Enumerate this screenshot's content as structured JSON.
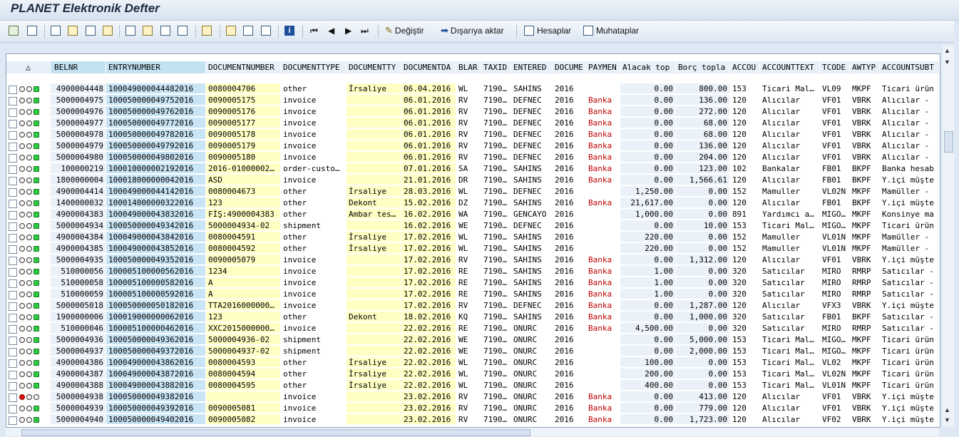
{
  "window": {
    "title": "PLANET Elektronik Defter"
  },
  "toolbar": {
    "change_label": "Değiştir",
    "export_label": "Dışarıya aktar",
    "accounts_label": "Hesaplar",
    "counterparties_label": "Muhataplar",
    "nav": [
      "⏮",
      "◀",
      "▶",
      "⏭"
    ]
  },
  "table": {
    "sort_icon": "△",
    "columns": [
      "BELNR",
      "ENTRYNUMBER",
      "DOCUMENTNUMBER",
      "DOCUMENTTYPE",
      "DOCUMENTTY",
      "DOCUMENTDA",
      "BLAR",
      "TAXID",
      "ENTERED",
      "DOCUME",
      "PAYMEN",
      "Alacak top",
      "Borç topla",
      "ACCOU",
      "ACCOUNTTEXT",
      "TCODE",
      "AWTYP",
      "ACCOUNTSUBT"
    ],
    "rows": [
      [
        "4900004448",
        "100049000044482016",
        "0080004706",
        "other",
        "İrsaliye",
        "06.04.2016",
        "WL",
        "7190…",
        "SAHINS",
        "2016",
        "",
        "0.00",
        "800.00",
        "153",
        "Ticari Mal…",
        "VL09",
        "MKPF",
        "Ticari ürün"
      ],
      [
        "5000004975",
        "100050000049752016",
        "0090005175",
        "invoice",
        "",
        "06.01.2016",
        "RV",
        "7190…",
        "DEFNEC",
        "2016",
        "Banka",
        "0.00",
        "136.00",
        "120",
        "Alıcılar",
        "VF01",
        "VBRK",
        "Alıcılar -"
      ],
      [
        "5000004976",
        "100050000049762016",
        "0090005176",
        "invoice",
        "",
        "06.01.2016",
        "RV",
        "7190…",
        "DEFNEC",
        "2016",
        "Banka",
        "0.00",
        "272.00",
        "120",
        "Alıcılar",
        "VF01",
        "VBRK",
        "Alıcılar -"
      ],
      [
        "5000004977",
        "100050000049772016",
        "0090005177",
        "invoice",
        "",
        "06.01.2016",
        "RV",
        "7190…",
        "DEFNEC",
        "2016",
        "Banka",
        "0.00",
        "68.00",
        "120",
        "Alıcılar",
        "VF01",
        "VBRK",
        "Alıcılar -"
      ],
      [
        "5000004978",
        "100050000049782016",
        "0090005178",
        "invoice",
        "",
        "06.01.2016",
        "RV",
        "7190…",
        "DEFNEC",
        "2016",
        "Banka",
        "0.00",
        "68.00",
        "120",
        "Alıcılar",
        "VF01",
        "VBRK",
        "Alıcılar -"
      ],
      [
        "5000004979",
        "100050000049792016",
        "0090005179",
        "invoice",
        "",
        "06.01.2016",
        "RV",
        "7190…",
        "DEFNEC",
        "2016",
        "Banka",
        "0.00",
        "136.00",
        "120",
        "Alıcılar",
        "VF01",
        "VBRK",
        "Alıcılar -"
      ],
      [
        "5000004980",
        "100050000049802016",
        "0090005180",
        "invoice",
        "",
        "06.01.2016",
        "RV",
        "7190…",
        "DEFNEC",
        "2016",
        "Banka",
        "0.00",
        "204.00",
        "120",
        "Alıcılar",
        "VF01",
        "VBRK",
        "Alıcılar -"
      ],
      [
        "100000219",
        "100010000002192016",
        "2016-01000002…",
        "order-custo…",
        "",
        "07.01.2016",
        "SA",
        "7190…",
        "SAHINS",
        "2016",
        "Banka",
        "0.00",
        "123.00",
        "102",
        "Bankalar",
        "FB01",
        "BKPF",
        "Banka hesab"
      ],
      [
        "1800000004",
        "100018000000042016",
        "ASD",
        "invoice",
        "",
        "21.01.2016",
        "DR",
        "7190…",
        "SAHINS",
        "2016",
        "Banka",
        "0.00",
        "1,566.61",
        "120",
        "Alıcılar",
        "FB01",
        "BKPF",
        "Y.içi müşte"
      ],
      [
        "4900004414",
        "100049000044142016",
        "0080004673",
        "other",
        "İrsaliye",
        "28.03.2016",
        "WL",
        "7190…",
        "DEFNEC",
        "2016",
        "",
        "1,250.00",
        "0.00",
        "152",
        "Mamuller",
        "VL02N",
        "MKPF",
        "Mamüller -"
      ],
      [
        "1400000032",
        "100014000000322016",
        "123",
        "other",
        "Dekont",
        "15.02.2016",
        "DZ",
        "7190…",
        "SAHINS",
        "2016",
        "Banka",
        "21,617.00",
        "0.00",
        "120",
        "Alıcılar",
        "FB01",
        "BKPF",
        "Y.içi müşte"
      ],
      [
        "4900004383",
        "100049000043832016",
        "FİŞ:4900004383",
        "other",
        "Ambar tes…",
        "16.02.2016",
        "WA",
        "7190…",
        "GENCAYO",
        "2016",
        "",
        "1,000.00",
        "0.00",
        "891",
        "Yardımcı a…",
        "MIGO…",
        "MKPF",
        "Konsinye ma"
      ],
      [
        "5000004934",
        "100050000049342016",
        "5000004934-02",
        "shipment",
        "",
        "16.02.2016",
        "WE",
        "7190…",
        "DEFNEC",
        "2016",
        "",
        "0.00",
        "10.00",
        "153",
        "Ticari Mal…",
        "MIGO…",
        "MKPF",
        "Ticari ürün"
      ],
      [
        "4900004384",
        "100049000043842016",
        "0080004591",
        "other",
        "İrsaliye",
        "17.02.2016",
        "WL",
        "7190…",
        "SAHINS",
        "2016",
        "",
        "220.00",
        "0.00",
        "152",
        "Mamuller",
        "VL01N",
        "MKPF",
        "Mamüller -"
      ],
      [
        "4900004385",
        "100049000043852016",
        "0080004592",
        "other",
        "İrsaliye",
        "17.02.2016",
        "WL",
        "7190…",
        "SAHINS",
        "2016",
        "",
        "220.00",
        "0.00",
        "152",
        "Mamuller",
        "VL01N",
        "MKPF",
        "Mamüller -"
      ],
      [
        "5000004935",
        "100050000049352016",
        "0090005079",
        "invoice",
        "",
        "17.02.2016",
        "RV",
        "7190…",
        "SAHINS",
        "2016",
        "Banka",
        "0.00",
        "1,312.00",
        "120",
        "Alıcılar",
        "VF01",
        "VBRK",
        "Y.içi müşte"
      ],
      [
        "510000056",
        "100005100000562016",
        "1234",
        "invoice",
        "",
        "17.02.2016",
        "RE",
        "7190…",
        "SAHINS",
        "2016",
        "Banka",
        "1.00",
        "0.00",
        "320",
        "Satıcılar",
        "MIRO",
        "RMRP",
        "Satıcılar -"
      ],
      [
        "510000058",
        "100005100000582016",
        "A",
        "invoice",
        "",
        "17.02.2016",
        "RE",
        "7190…",
        "SAHINS",
        "2016",
        "Banka",
        "1.00",
        "0.00",
        "320",
        "Satıcılar",
        "MIRO",
        "RMRP",
        "Satıcılar -"
      ],
      [
        "510000059",
        "100005100000592016",
        "A",
        "invoice",
        "",
        "17.02.2016",
        "RE",
        "7190…",
        "SAHINS",
        "2016",
        "Banka",
        "1.00",
        "0.00",
        "320",
        "Satıcılar",
        "MIRO",
        "RMRP",
        "Satıcılar -"
      ],
      [
        "5000005018",
        "100050000050182016",
        "TTA2016000000…",
        "invoice",
        "",
        "17.02.2016",
        "RV",
        "7190…",
        "DEFNEC",
        "2016",
        "Banka",
        "0.00",
        "1,287.00",
        "120",
        "Alıcılar",
        "VFX3",
        "VBRK",
        "Y.içi müşte"
      ],
      [
        "1900000006",
        "100019000000062016",
        "123",
        "other",
        "Dekont",
        "18.02.2016",
        "KQ",
        "7190…",
        "SAHINS",
        "2016",
        "Banka",
        "0.00",
        "1,000.00",
        "320",
        "Satıcılar",
        "FB01",
        "BKPF",
        "Satıcılar -"
      ],
      [
        "510000046",
        "100005100000462016",
        "XXC2015000000…",
        "invoice",
        "",
        "22.02.2016",
        "RE",
        "7190…",
        "ONURC",
        "2016",
        "Banka",
        "4,500.00",
        "0.00",
        "320",
        "Satıcılar",
        "MIRO",
        "RMRP",
        "Satıcılar -"
      ],
      [
        "5000004936",
        "100050000049362016",
        "5000004936-02",
        "shipment",
        "",
        "22.02.2016",
        "WE",
        "7190…",
        "ONURC",
        "2016",
        "",
        "0.00",
        "5,000.00",
        "153",
        "Ticari Mal…",
        "MIGO…",
        "MKPF",
        "Ticari ürün"
      ],
      [
        "5000004937",
        "100050000049372016",
        "5000004937-02",
        "shipment",
        "",
        "22.02.2016",
        "WE",
        "7190…",
        "ONURC",
        "2016",
        "",
        "0.00",
        "2,000.00",
        "153",
        "Ticari Mal…",
        "MIGO…",
        "MKPF",
        "Ticari ürün"
      ],
      [
        "4900004386",
        "100049000043862016",
        "0080004593",
        "other",
        "İrsaliye",
        "22.02.2016",
        "WL",
        "7190…",
        "ONURC",
        "2016",
        "",
        "100.00",
        "0.00",
        "153",
        "Ticari Mal…",
        "VL02",
        "MKPF",
        "Ticari ürün"
      ],
      [
        "4900004387",
        "100049000043872016",
        "0080004594",
        "other",
        "İrsaliye",
        "22.02.2016",
        "WL",
        "7190…",
        "ONURC",
        "2016",
        "",
        "200.00",
        "0.00",
        "153",
        "Ticari Mal…",
        "VL02N",
        "MKPF",
        "Ticari ürün"
      ],
      [
        "4900004388",
        "100049000043882016",
        "0080004595",
        "other",
        "İrsaliye",
        "22.02.2016",
        "WL",
        "7190…",
        "ONURC",
        "2016",
        "",
        "400.00",
        "0.00",
        "153",
        "Ticari Mal…",
        "VL01N",
        "MKPF",
        "Ticari ürün"
      ],
      [
        "5000004938",
        "100050000049382016",
        "",
        "invoice",
        "",
        "23.02.2016",
        "RV",
        "7190…",
        "ONURC",
        "2016",
        "Banka",
        "0.00",
        "413.00",
        "120",
        "Alıcılar",
        "VF01",
        "VBRK",
        "Y.içi müşte"
      ],
      [
        "5000004939",
        "100050000049392016",
        "0090005081",
        "invoice",
        "",
        "23.02.2016",
        "RV",
        "7190…",
        "ONURC",
        "2016",
        "Banka",
        "0.00",
        "779.00",
        "120",
        "Alıcılar",
        "VF01",
        "VBRK",
        "Y.içi müşte"
      ],
      [
        "5000004940",
        "100050000049402016",
        "0090005082",
        "invoice",
        "",
        "23.02.2016",
        "RV",
        "7190…",
        "ONURC",
        "2016",
        "Banka",
        "0.00",
        "1,723.00",
        "120",
        "Alıcılar",
        "VF02",
        "VBRK",
        "Y.içi müşte"
      ]
    ],
    "status": [
      "green",
      "green",
      "green",
      "green",
      "green",
      "green",
      "green",
      "green",
      "green",
      "green",
      "green",
      "green",
      "green",
      "green",
      "green",
      "green",
      "green",
      "green",
      "green",
      "green",
      "green",
      "green",
      "green",
      "green",
      "green",
      "green",
      "green",
      "red",
      "green",
      "green"
    ]
  },
  "colors": {
    "accent_blue": "#c2e2f2",
    "highlight_yellow": "#ffffc4",
    "payment_red": "#c00000"
  }
}
